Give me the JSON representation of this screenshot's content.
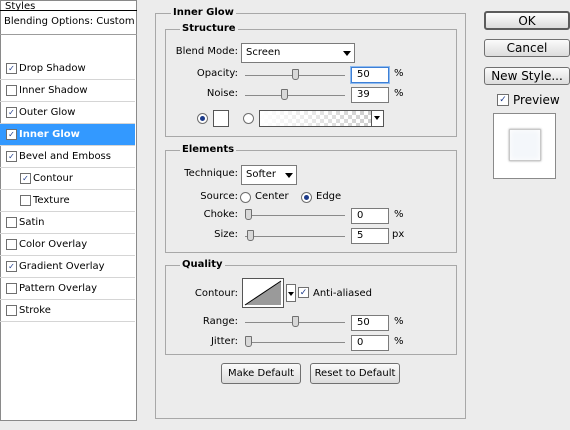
{
  "styles_panel": {
    "header": "Styles",
    "blending_options": "Blending Options: Custom",
    "items": [
      {
        "label": "Drop Shadow",
        "checked": true,
        "selected": false,
        "indent": false
      },
      {
        "label": "Inner Shadow",
        "checked": false,
        "selected": false,
        "indent": false
      },
      {
        "label": "Outer Glow",
        "checked": true,
        "selected": false,
        "indent": false
      },
      {
        "label": "Inner Glow",
        "checked": true,
        "selected": true,
        "indent": false
      },
      {
        "label": "Bevel and Emboss",
        "checked": true,
        "selected": false,
        "indent": false
      },
      {
        "label": "Contour",
        "checked": true,
        "selected": false,
        "indent": true
      },
      {
        "label": "Texture",
        "checked": false,
        "selected": false,
        "indent": true
      },
      {
        "label": "Satin",
        "checked": false,
        "selected": false,
        "indent": false
      },
      {
        "label": "Color Overlay",
        "checked": false,
        "selected": false,
        "indent": false
      },
      {
        "label": "Gradient Overlay",
        "checked": true,
        "selected": false,
        "indent": false
      },
      {
        "label": "Pattern Overlay",
        "checked": false,
        "selected": false,
        "indent": false
      },
      {
        "label": "Stroke",
        "checked": false,
        "selected": false,
        "indent": false
      }
    ]
  },
  "inner_glow": {
    "title": "Inner Glow",
    "structure": {
      "title": "Structure",
      "blend_mode_label": "Blend Mode:",
      "blend_mode_value": "Screen",
      "opacity_label": "Opacity:",
      "opacity_value": "50",
      "opacity_unit": "%",
      "opacity_level": 0.5,
      "noise_label": "Noise:",
      "noise_value": "39",
      "noise_unit": "%",
      "noise_level": 0.39,
      "color_mode": "solid",
      "solid_color": "#ffffff"
    },
    "elements": {
      "title": "Elements",
      "technique_label": "Technique:",
      "technique_value": "Softer",
      "source_label": "Source:",
      "source_center": "Center",
      "source_edge": "Edge",
      "source_selected": "Edge",
      "choke_label": "Choke:",
      "choke_value": "0",
      "choke_unit": "%",
      "choke_level": 0,
      "size_label": "Size:",
      "size_value": "5",
      "size_unit": "px",
      "size_level": 0.02
    },
    "quality": {
      "title": "Quality",
      "contour_label": "Contour:",
      "anti_aliased_label": "Anti-aliased",
      "anti_aliased": true,
      "range_label": "Range:",
      "range_value": "50",
      "range_unit": "%",
      "range_level": 0.5,
      "jitter_label": "Jitter:",
      "jitter_value": "0",
      "jitter_unit": "%",
      "jitter_level": 0
    },
    "make_default": "Make Default",
    "reset_default": "Reset to Default"
  },
  "right_panel": {
    "ok": "OK",
    "cancel": "Cancel",
    "new_style": "New Style...",
    "preview_label": "Preview",
    "preview_checked": true
  },
  "colors": {
    "selection": "#3399ff",
    "checkmark": "#1d3b8a"
  }
}
